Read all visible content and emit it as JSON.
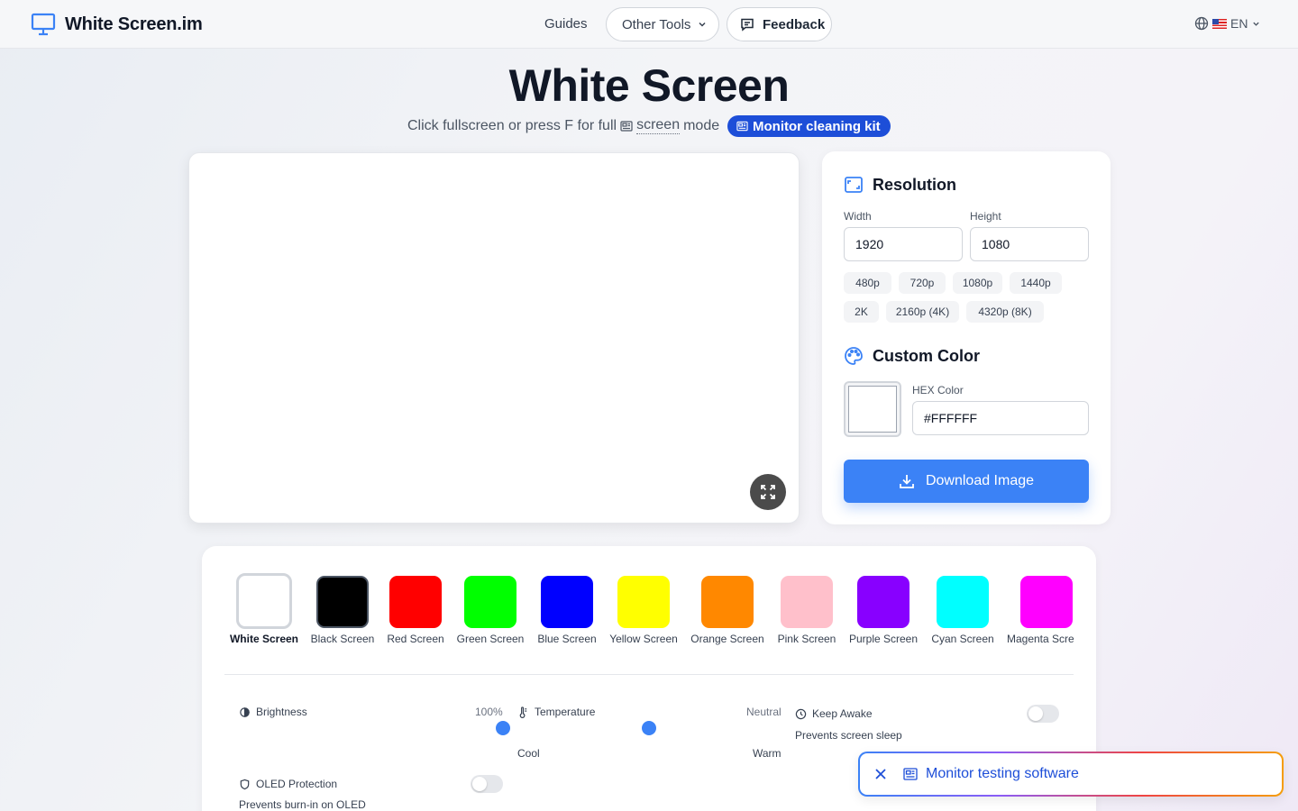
{
  "header": {
    "logo_text": "White Screen.im",
    "nav": {
      "guides": "Guides",
      "other_tools": "Other Tools",
      "feedback": "Feedback"
    },
    "language": "EN"
  },
  "hero": {
    "title": "White Screen",
    "subtitle_prefix": "Click fullscreen or press F for full",
    "subtitle_link": "screen",
    "subtitle_suffix": "mode",
    "badge": "Monitor cleaning kit"
  },
  "preview": {
    "color": "#FFFFFF"
  },
  "resolution": {
    "title": "Resolution",
    "width_label": "Width",
    "height_label": "Height",
    "width_value": "1920",
    "height_value": "1080",
    "presets": [
      "480p",
      "720p",
      "1080p",
      "1440p",
      "2K",
      "2160p (4K)",
      "4320p (8K)"
    ]
  },
  "custom_color": {
    "title": "Custom Color",
    "hex_label": "HEX Color",
    "hex_value": "#FFFFFF"
  },
  "download_label": "Download Image",
  "colors": [
    {
      "name": "White Screen",
      "hex": "#FFFFFF",
      "selected": true
    },
    {
      "name": "Black Screen",
      "hex": "#000000"
    },
    {
      "name": "Red Screen",
      "hex": "#FF0000"
    },
    {
      "name": "Green Screen",
      "hex": "#00FF00"
    },
    {
      "name": "Blue Screen",
      "hex": "#0000FF"
    },
    {
      "name": "Yellow Screen",
      "hex": "#FFFF00"
    },
    {
      "name": "Orange Screen",
      "hex": "#FF8800"
    },
    {
      "name": "Pink Screen",
      "hex": "#FFC0CB"
    },
    {
      "name": "Purple Screen",
      "hex": "#8800FF"
    },
    {
      "name": "Cyan Screen",
      "hex": "#00FFFF"
    },
    {
      "name": "Magenta Screen",
      "hex": "#FF00FF"
    }
  ],
  "controls": {
    "brightness": {
      "label": "Brightness",
      "value": "100%",
      "fraction": 1.0
    },
    "temperature": {
      "label": "Temperature",
      "value": "Neutral",
      "cool": "Cool",
      "warm": "Warm",
      "fraction": 0.5
    },
    "keep_awake": {
      "label": "Keep Awake",
      "description": "Prevents screen sleep",
      "enabled": false
    },
    "oled": {
      "label": "OLED Protection",
      "description": "Prevents burn-in on OLED",
      "enabled": false
    }
  },
  "toast": {
    "text": "Monitor testing software"
  },
  "theme": {
    "accent": "#3B82F6",
    "badge": "#1D4ED8"
  }
}
